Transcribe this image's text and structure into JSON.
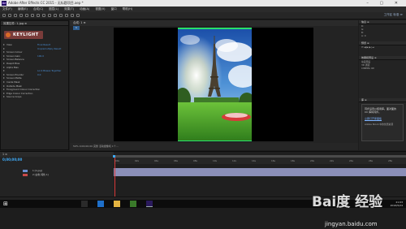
{
  "window": {
    "title": "Adobe After Effects CC 2015 - 无标题项目.aep *",
    "logo": "Ae"
  },
  "menu": [
    "文件(F)",
    "编辑(E)",
    "合成(C)",
    "图层(L)",
    "效果(T)",
    "动画(A)",
    "视图(V)",
    "窗口",
    "帮助(H)"
  ],
  "toolbar": {
    "right_label": "工作区 标准 ≫"
  },
  "effect_controls": {
    "tab": "效果控件: 1.jpg ≡",
    "effect_name": "KEYLIGHT",
    "properties": [
      {
        "name": "View",
        "value": "Final Result"
      },
      {
        "name": "",
        "value": "Unpremultiply Result"
      },
      {
        "name": "Screen Colour",
        "value": ""
      },
      {
        "name": "Screen Gain",
        "value": "100.0"
      },
      {
        "name": "Screen Balance",
        "value": ""
      },
      {
        "name": "Despill Bias",
        "value": ""
      },
      {
        "name": "Alpha Bias",
        "value": ""
      },
      {
        "name": "",
        "value": "Lock Biases Together"
      },
      {
        "name": "Screen Pre-blur",
        "value": "0.0"
      },
      {
        "name": "Screen Matte",
        "value": ""
      },
      {
        "name": "Inside Mask",
        "value": ""
      },
      {
        "name": "Outside Mask",
        "value": ""
      },
      {
        "name": "Foreground Colour Correction",
        "value": ""
      },
      {
        "name": "Edge Colour Correction",
        "value": ""
      },
      {
        "name": "Source Crops",
        "value": ""
      }
    ]
  },
  "viewer": {
    "tab": "合成: 1 ≡",
    "subtab": "1",
    "status": "50%   0;00;00;00   完整   活动摄像机   1个..."
  },
  "right_panel": {
    "sec1_header": "信息 ≡",
    "sec1_lines": [
      "R:",
      "G:",
      "B:",
      "A: 0"
    ],
    "sec2_header": "预览 ≡",
    "sec3_header": "效果和预设 ≡",
    "sec3_lines": [
      "动画预设",
      "3D 通道",
      "CINEMA 4D"
    ],
    "library_header": "库 ≡",
    "library_text": "同步设置以使用库。面对面的 CC 库将同步。",
    "library_button": "立即打开库面板",
    "library_footer": "Adobe Stock 中的优质资源"
  },
  "timeline": {
    "tab": "1 ≡",
    "timecode": "0;00;00;00",
    "layers": [
      {
        "num": "1",
        "name": "[1.jpg]",
        "color": "#6a8fd0"
      },
      {
        "num": "2",
        "name": "[白色 纯色 1]",
        "color": "#c84a4a"
      }
    ],
    "ruler": [
      "00s",
      "02s",
      "04s",
      "06s",
      "08s",
      "10s",
      "12s",
      "14s",
      "16s",
      "18s",
      "20s",
      "22s",
      "24s",
      "26s",
      "28s"
    ]
  },
  "taskbar": {
    "time": "21:03",
    "date": "2016/5/24"
  },
  "watermark": {
    "brand": "Bai度 经验",
    "url": "jingyan.baidu.com"
  }
}
